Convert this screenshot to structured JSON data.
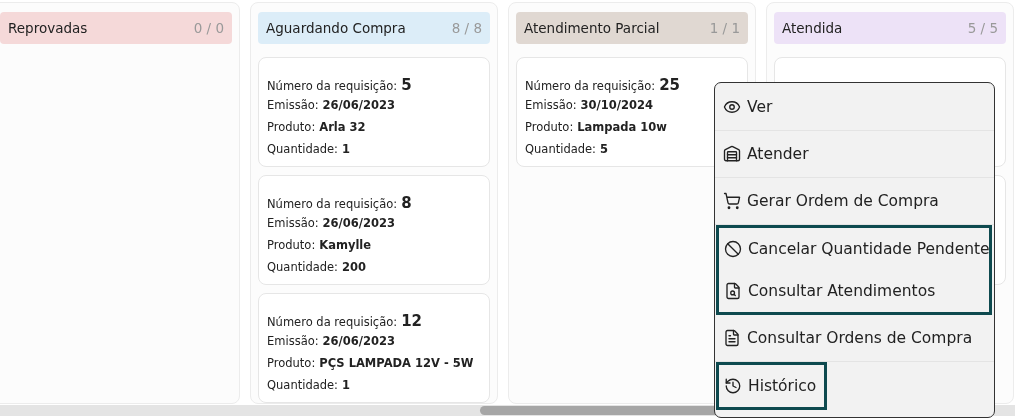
{
  "columns": [
    {
      "title": "Reprovadas",
      "count": "0 / 0",
      "color": "#f5d9d9"
    },
    {
      "title": "Aguardando Compra",
      "count": "8 / 8",
      "color": "#dcedf8",
      "cards": [
        {
          "kind": "request",
          "number_label": "Número da requisição:",
          "number": "5",
          "emission_label": "Emissão:",
          "emission": "26/06/2023",
          "product_label": "Produto:",
          "product": "Arla 32",
          "quantity_label": "Quantidade:",
          "quantity": "1"
        },
        {
          "kind": "request",
          "number_label": "Número da requisição:",
          "number": "8",
          "emission_label": "Emissão:",
          "emission": "26/06/2023",
          "product_label": "Produto:",
          "product": "Kamylle",
          "quantity_label": "Quantidade:",
          "quantity": "200"
        },
        {
          "kind": "request",
          "number_label": "Número da requisição:",
          "number": "12",
          "emission_label": "Emissão:",
          "emission": "26/06/2023",
          "product_label": "Produto:",
          "product": "PÇS LAMPADA 12V - 5W",
          "quantity_label": "Quantidade:",
          "quantity": "1"
        }
      ]
    },
    {
      "title": "Atendimento Parcial",
      "count": "1 / 1",
      "color": "#e0d8d2",
      "cards": [
        {
          "kind": "request",
          "number_label": "Número da requisição:",
          "number": "25",
          "emission_label": "Emissão:",
          "emission": "30/10/2024",
          "product_label": "Produto:",
          "product": "Lampada 10w",
          "quantity_label": "Quantidade:",
          "quantity": "5"
        }
      ]
    },
    {
      "title": "Atendida",
      "count": "5 / 5",
      "color": "#ede2f7",
      "cards": [
        {
          "kind": "covered"
        },
        {
          "kind": "covered"
        }
      ]
    }
  ],
  "context_menu": {
    "items": [
      {
        "kind": "eye",
        "label": "Ver",
        "highlighted": false
      },
      {
        "kind": "warehouse",
        "label": "Atender",
        "highlighted": false
      },
      {
        "kind": "cart",
        "label": "Gerar Ordem de Compra",
        "highlighted": false
      },
      {
        "kind": "ban",
        "label": "Cancelar Quantidade Pendente",
        "highlighted": true
      },
      {
        "kind": "file-search",
        "label": "Consultar Atendimentos",
        "highlighted": true
      },
      {
        "kind": "file",
        "label": "Consultar Ordens de Compra",
        "highlighted": false
      },
      {
        "kind": "history",
        "label": "Histórico",
        "highlighted": true
      }
    ]
  }
}
